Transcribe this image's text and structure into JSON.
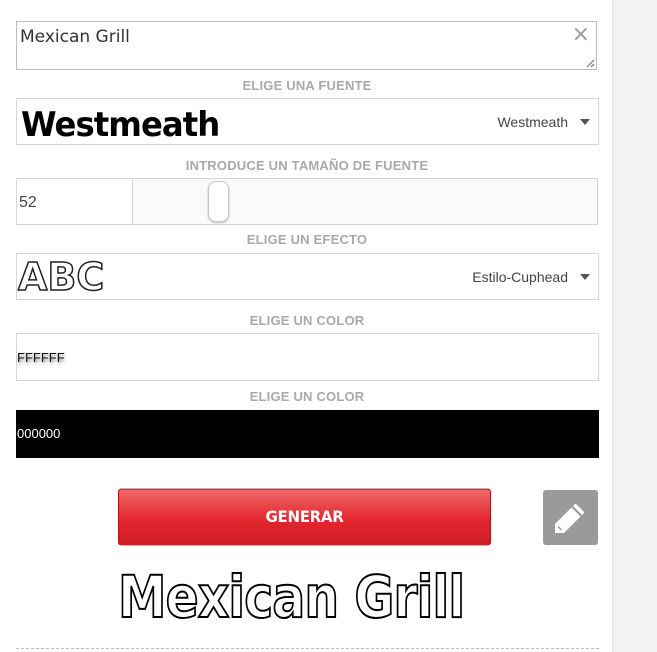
{
  "text_input": {
    "value": "Mexican Grill",
    "clear_icon": "×"
  },
  "font_section": {
    "label": "ELIGE UNA FUENTE",
    "preview_text": "Westmeath",
    "selected": "Westmeath"
  },
  "size_section": {
    "label": "INTRODUCE UN TAMAÑO DE FUENTE",
    "value": "52",
    "slider_level": 0.17
  },
  "effect_section": {
    "label": "ELIGE UN EFECTO",
    "preview_text": "ABC",
    "selected": "Estilo-Cuphead"
  },
  "color_section_1": {
    "label": "ELIGE UN COLOR",
    "hex": "FFFFFF",
    "background": "#ffffff"
  },
  "color_section_2": {
    "label": "ELIGE UN COLOR",
    "hex": "000000",
    "background": "#000000"
  },
  "actions": {
    "generate_label": "GENERAR",
    "edit_icon": "pencil-icon"
  },
  "result": {
    "text": "Mexican Grill"
  },
  "colors": {
    "accent_button": "#e3262d",
    "label_gray": "#a9a9a9",
    "edit_button_bg": "#9a9a9a"
  }
}
